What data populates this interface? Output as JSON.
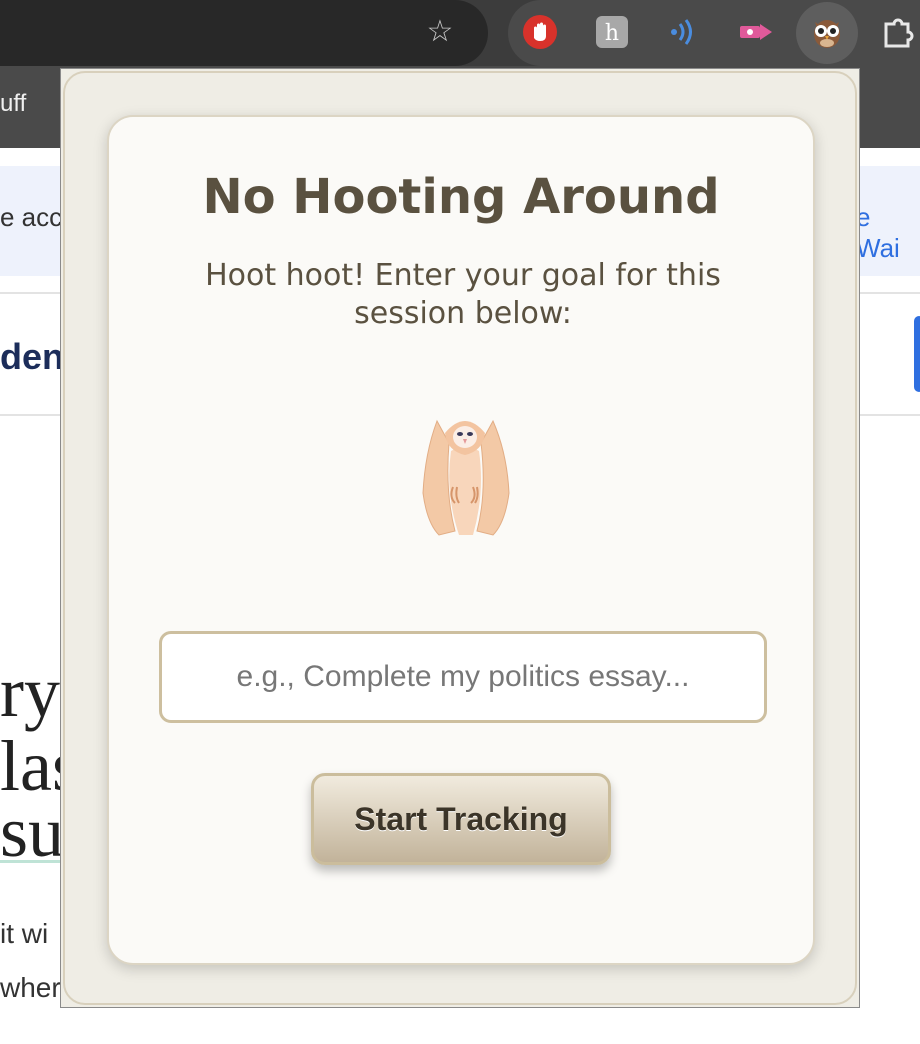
{
  "browser": {
    "tab_text": "uff",
    "bookmark_icon": "star-icon",
    "extensions": [
      "hand-stop-icon",
      "h-extension-icon",
      "broadcast-icon",
      "video-arrow-icon",
      "owl-icon",
      "puzzle-icon"
    ]
  },
  "page": {
    "banner_left": "e acce",
    "banner_right": "e Wai",
    "nav_text": "den",
    "big_lines": [
      "ry",
      "las",
      "su"
    ],
    "small_lines": [
      "it wi",
      "wher"
    ]
  },
  "popup": {
    "title": "No Hooting Around",
    "subtitle": "Hoot hoot! Enter your goal for this session below:",
    "input_placeholder": "e.g., Complete my politics essay...",
    "input_value": "",
    "button_label": "Start Tracking",
    "colors": {
      "text": "#5a5140",
      "button_top": "#f1ebde",
      "button_bottom": "#c2b39a",
      "border": "#cdbf9f"
    }
  }
}
